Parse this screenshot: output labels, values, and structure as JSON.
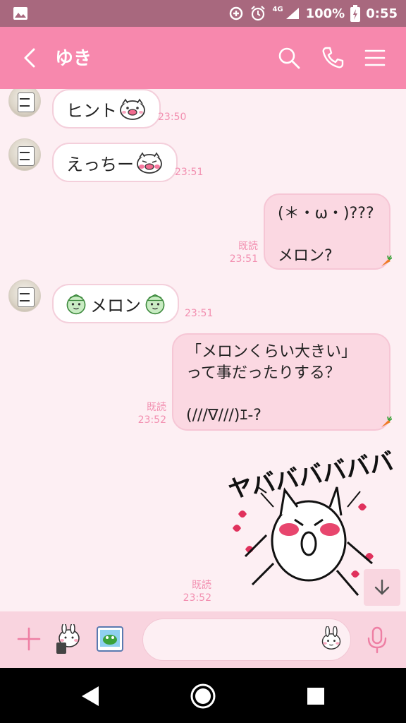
{
  "status_bar": {
    "network": "4G",
    "battery": "100%",
    "time": "0:55",
    "icons": [
      "gallery-icon",
      "data-saver-icon",
      "alarm-icon",
      "signal-icon",
      "battery-icon"
    ]
  },
  "header": {
    "title": "ゆき",
    "icons": [
      "back-icon",
      "search-icon",
      "phone-icon",
      "menu-icon"
    ]
  },
  "messages": [
    {
      "side": "in",
      "text": "ヒント",
      "time": "23:50",
      "sticker": "pig-face"
    },
    {
      "side": "in",
      "text": "えっちー",
      "time": "23:51",
      "sticker": "pig-blush"
    },
    {
      "side": "out",
      "lines": [
        "(＊・ω・)???",
        "",
        "メロン?"
      ],
      "read": "既読",
      "time": "23:51"
    },
    {
      "side": "in",
      "text": "メロン",
      "time": "23:51",
      "sticker": "melon-face"
    },
    {
      "side": "out",
      "lines": [
        "「メロンくらい大きい」",
        "って事だったりする？",
        "",
        "(///∇///)ｴ-?"
      ],
      "read": "既読",
      "time": "23:52"
    },
    {
      "side": "out",
      "sticker_text": "ヤババババババ",
      "read": "既読",
      "time": "23:52"
    }
  ],
  "input": {
    "placeholder": "",
    "icons": [
      "plus-icon",
      "sticker-icon",
      "image-icon",
      "emoji-icon",
      "mic-icon"
    ]
  },
  "colors": {
    "header": "#f788ad",
    "status_bar": "#a8687e",
    "chat_bg": "#fdeff3",
    "bubble_out": "#fbd8e2",
    "timestamp": "#f28fb0"
  }
}
